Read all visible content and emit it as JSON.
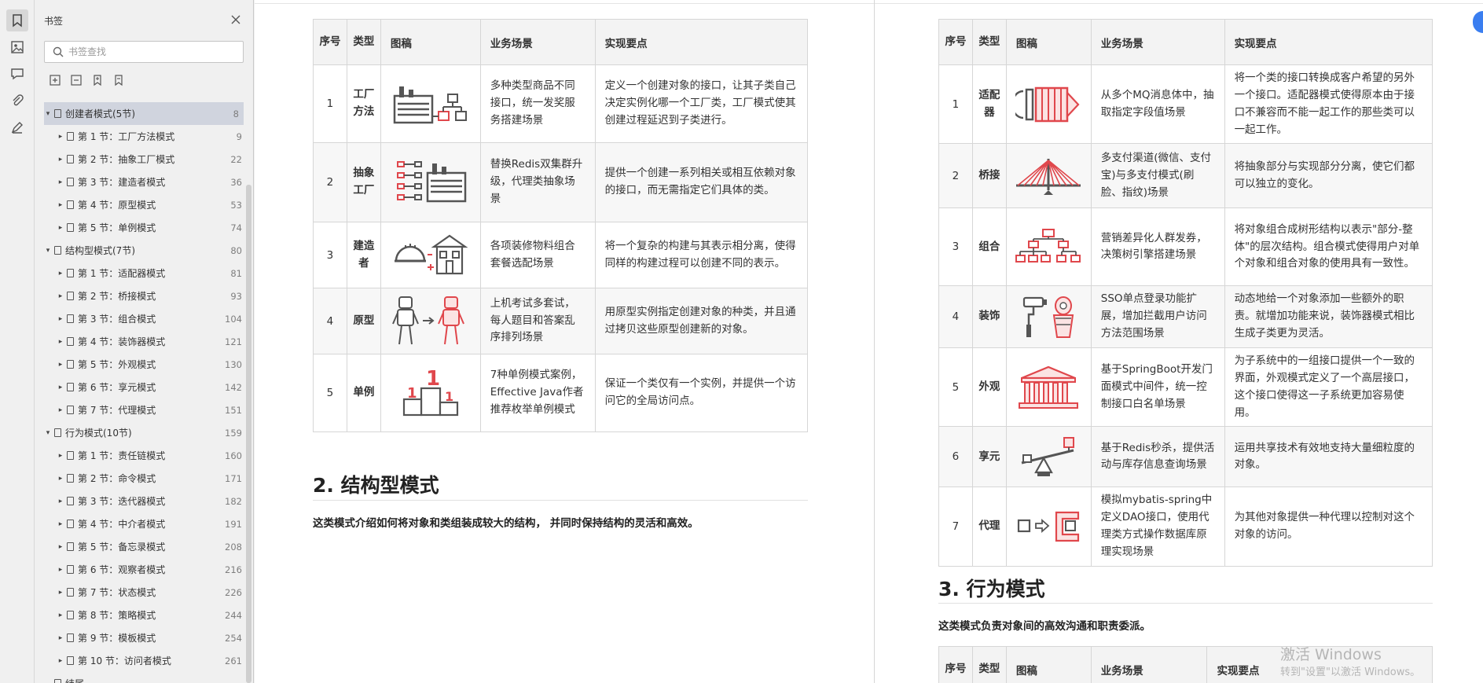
{
  "sidebar": {
    "title": "书签",
    "search_placeholder": "书签查找",
    "items": [
      {
        "label": "创建者模式(5节)",
        "page": "8",
        "level": 0
      },
      {
        "label": "第 1 节：工厂方法模式",
        "page": "9",
        "level": 1
      },
      {
        "label": "第 2 节：抽象工厂模式",
        "page": "22",
        "level": 1
      },
      {
        "label": "第 3 节：建造者模式",
        "page": "36",
        "level": 1
      },
      {
        "label": "第 4 节：原型模式",
        "page": "53",
        "level": 1
      },
      {
        "label": "第 5 节：单例模式",
        "page": "74",
        "level": 1
      },
      {
        "label": "结构型模式(7节)",
        "page": "80",
        "level": 0
      },
      {
        "label": "第 1 节：适配器模式",
        "page": "81",
        "level": 1
      },
      {
        "label": "第 2 节：桥接模式",
        "page": "93",
        "level": 1
      },
      {
        "label": "第 3 节：组合模式",
        "page": "104",
        "level": 1
      },
      {
        "label": "第 4 节：装饰器模式",
        "page": "121",
        "level": 1
      },
      {
        "label": "第 5 节：外观模式",
        "page": "130",
        "level": 1
      },
      {
        "label": "第 6 节：享元模式",
        "page": "142",
        "level": 1
      },
      {
        "label": "第 7 节：代理模式",
        "page": "151",
        "level": 1
      },
      {
        "label": "行为模式(10节)",
        "page": "159",
        "level": 0
      },
      {
        "label": "第 1 节：责任链模式",
        "page": "160",
        "level": 1
      },
      {
        "label": "第 2 节：命令模式",
        "page": "171",
        "level": 1
      },
      {
        "label": "第 3 节：迭代器模式",
        "page": "182",
        "level": 1
      },
      {
        "label": "第 4 节：中介者模式",
        "page": "191",
        "level": 1
      },
      {
        "label": "第 5 节：备忘录模式",
        "page": "208",
        "level": 1
      },
      {
        "label": "第 6 节：观察者模式",
        "page": "216",
        "level": 1
      },
      {
        "label": "第 7 节：状态模式",
        "page": "226",
        "level": 1
      },
      {
        "label": "第 8 节：策略模式",
        "page": "244",
        "level": 1
      },
      {
        "label": "第 9 节：模板模式",
        "page": "254",
        "level": 1
      },
      {
        "label": "第 10 节：访问者模式",
        "page": "261",
        "level": 1
      },
      {
        "label": "结尾",
        "page": "",
        "level": 0
      }
    ]
  },
  "columns": {
    "no": "序号",
    "type": "类型",
    "icon": "图稿",
    "scene": "业务场景",
    "key": "实现要点"
  },
  "left_page": {
    "rows": [
      {
        "no": "1",
        "type": "工厂方法",
        "icon": "factory-method-icon",
        "scene": "多种类型商品不同接口，统一发奖服务搭建场景",
        "key": "定义一个创建对象的接口，让其子类自己决定实例化哪一个工厂类，工厂模式使其创建过程延迟到子类进行。"
      },
      {
        "no": "2",
        "type": "抽象工厂",
        "icon": "abstract-factory-icon",
        "scene": "替换Redis双集群升级，代理类抽象场景",
        "key": "提供一个创建一系列相关或相互依赖对象的接口，而无需指定它们具体的类。"
      },
      {
        "no": "3",
        "type": "建造者",
        "icon": "builder-icon",
        "scene": "各项装修物料组合套餐选配场景",
        "key": "将一个复杂的构建与其表示相分离，使得同样的构建过程可以创建不同的表示。"
      },
      {
        "no": "4",
        "type": "原型",
        "icon": "prototype-icon",
        "scene": "上机考试多套试，每人题目和答案乱序排列场景",
        "key": "用原型实例指定创建对象的种类，并且通过拷贝这些原型创建新的对象。"
      },
      {
        "no": "5",
        "type": "单例",
        "icon": "singleton-icon",
        "scene": "7种单例模式案例，Effective Java作者推荐枚举单例模式",
        "key": "保证一个类仅有一个实例，并提供一个访问它的全局访问点。"
      }
    ],
    "section_title": "2. 结构型模式",
    "section_intro": "这类模式介绍如何将对象和类组装成较大的结构， 并同时保持结构的灵活和高效。"
  },
  "right_page": {
    "rows": [
      {
        "no": "1",
        "type": "适配器",
        "icon": "adapter-icon",
        "scene": "从多个MQ消息体中，抽取指定字段值场景",
        "key": "将一个类的接口转换成客户希望的另外一个接口。适配器模式使得原本由于接口不兼容而不能一起工作的那些类可以一起工作。"
      },
      {
        "no": "2",
        "type": "桥接",
        "icon": "bridge-icon",
        "scene": "多支付渠道(微信、支付宝)与多支付模式(刷脸、指纹)场景",
        "key": "将抽象部分与实现部分分离，使它们都可以独立的变化。"
      },
      {
        "no": "3",
        "type": "组合",
        "icon": "composite-icon",
        "scene": "营销差异化人群发券，决策树引擎搭建场景",
        "key": "将对象组合成树形结构以表示\"部分-整体\"的层次结构。组合模式使得用户对单个对象和组合对象的使用具有一致性。"
      },
      {
        "no": "4",
        "type": "装饰",
        "icon": "decorator-icon",
        "scene": "SSO单点登录功能扩展，增加拦截用户访问方法范围场景",
        "key": "动态地给一个对象添加一些额外的职责。就增加功能来说，装饰器模式相比生成子类更为灵活。"
      },
      {
        "no": "5",
        "type": "外观",
        "icon": "facade-icon",
        "scene": "基于SpringBoot开发门面模式中间件，统一控制接口白名单场景",
        "key": "为子系统中的一组接口提供一个一致的界面，外观模式定义了一个高层接口，这个接口使得这一子系统更加容易使用。"
      },
      {
        "no": "6",
        "type": "享元",
        "icon": "flyweight-icon",
        "scene": "基于Redis秒杀，提供活动与库存信息查询场景",
        "key": "运用共享技术有效地支持大量细粒度的对象。"
      },
      {
        "no": "7",
        "type": "代理",
        "icon": "proxy-icon",
        "scene": "模拟mybatis-spring中定义DAO接口，使用代理类方式操作数据库原理实现场景",
        "key": "为其他对象提供一种代理以控制对这个对象的访问。"
      }
    ],
    "section_title": "3. 行为模式",
    "section_intro": "这类模式负责对象间的高效沟通和职责委派。",
    "next_header": {
      "no": "序号",
      "type": "类型",
      "icon": "图稿",
      "scene": "业务场景",
      "key": "实现要点"
    }
  },
  "watermark": {
    "line1": "激活 Windows",
    "line2": "转到\"设置\"以激活 Windows。"
  },
  "colors": {
    "accent_red": "#e0474c",
    "icon_gray": "#555555",
    "selected_row": "#d0d4de"
  }
}
